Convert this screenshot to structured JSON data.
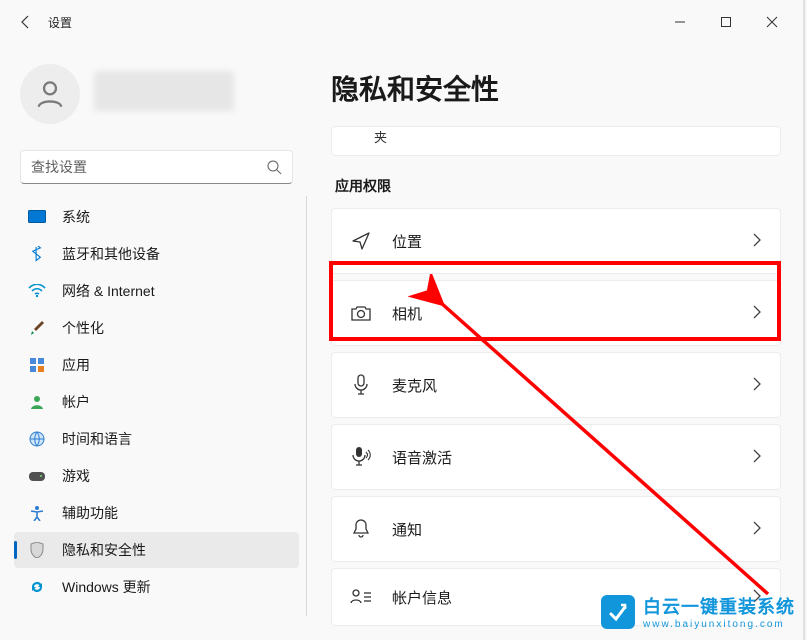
{
  "title": "设置",
  "search": {
    "placeholder": "查找设置"
  },
  "sidebar": {
    "items": [
      {
        "label": "系统"
      },
      {
        "label": "蓝牙和其他设备"
      },
      {
        "label": "网络 & Internet"
      },
      {
        "label": "个性化"
      },
      {
        "label": "应用"
      },
      {
        "label": "帐户"
      },
      {
        "label": "时间和语言"
      },
      {
        "label": "游戏"
      },
      {
        "label": "辅助功能"
      },
      {
        "label": "隐私和安全性"
      },
      {
        "label": "Windows 更新"
      }
    ]
  },
  "page": {
    "heading": "隐私和安全性",
    "stub": "夹",
    "section": "应用权限",
    "cards": [
      {
        "label": "位置"
      },
      {
        "label": "相机"
      },
      {
        "label": "麦克风"
      },
      {
        "label": "语音激活"
      },
      {
        "label": "通知"
      },
      {
        "label": "帐户信息"
      }
    ]
  },
  "watermark": {
    "brand": "白云一键重装系统",
    "url": "www.baiyunxitong.com"
  }
}
